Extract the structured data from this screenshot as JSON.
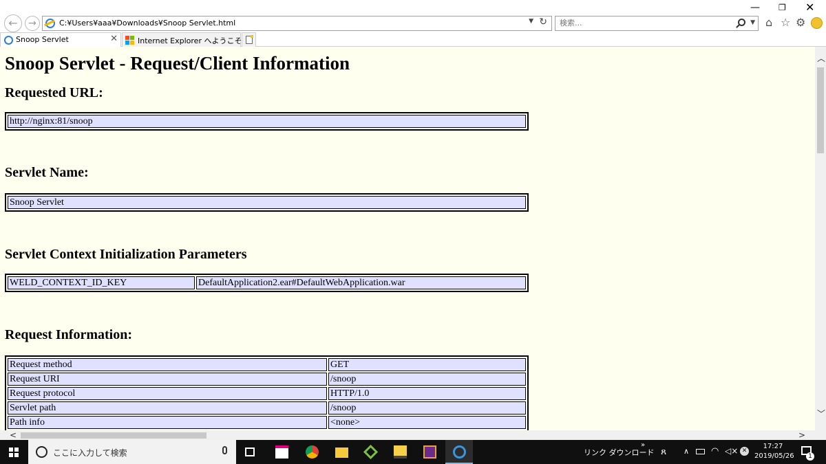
{
  "browser": {
    "address_url": "C:¥Users¥aaa¥Downloads¥Snoop Servlet.html",
    "search_placeholder": "検索...",
    "tabs": [
      {
        "label": "Snoop Servlet",
        "active": true
      },
      {
        "label": "Internet Explorer へようこそ",
        "active": false
      }
    ],
    "window_controls": {
      "minimize": "—",
      "restore": "❐",
      "close": "✕"
    }
  },
  "page": {
    "title": "Snoop Servlet - Request/Client Information",
    "sections": {
      "requested_url": {
        "heading": "Requested URL:",
        "rows": [
          [
            "http://nginx:81/snoop"
          ]
        ]
      },
      "servlet_name": {
        "heading": "Servlet Name:",
        "rows": [
          [
            "Snoop Servlet"
          ]
        ]
      },
      "context_params": {
        "heading": "Servlet Context Initialization Parameters",
        "rows": [
          [
            "WELD_CONTEXT_ID_KEY",
            "DefaultApplication2.ear#DefaultWebApplication.war"
          ]
        ]
      },
      "request_info": {
        "heading": "Request Information:",
        "rows": [
          [
            "Request method",
            "GET"
          ],
          [
            "Request URI",
            "/snoop"
          ],
          [
            "Request protocol",
            "HTTP/1.0"
          ],
          [
            "Servlet path",
            "/snoop"
          ],
          [
            "Path info",
            "<none>"
          ]
        ]
      }
    },
    "colors": {
      "page_background": "#fffff0",
      "cell_background": "#e0e0ff"
    }
  },
  "taskbar": {
    "search_placeholder": "ここに入力して検索",
    "tray_links": "リンク  ダウンロード",
    "tray_more": "»",
    "clock_time": "17:27",
    "clock_date": "2019/05/26",
    "notification_count": "1",
    "apps": [
      "task-view",
      "notepad",
      "chrome",
      "file-explorer",
      "vmware",
      "terminal",
      "game",
      "internet-explorer"
    ]
  }
}
